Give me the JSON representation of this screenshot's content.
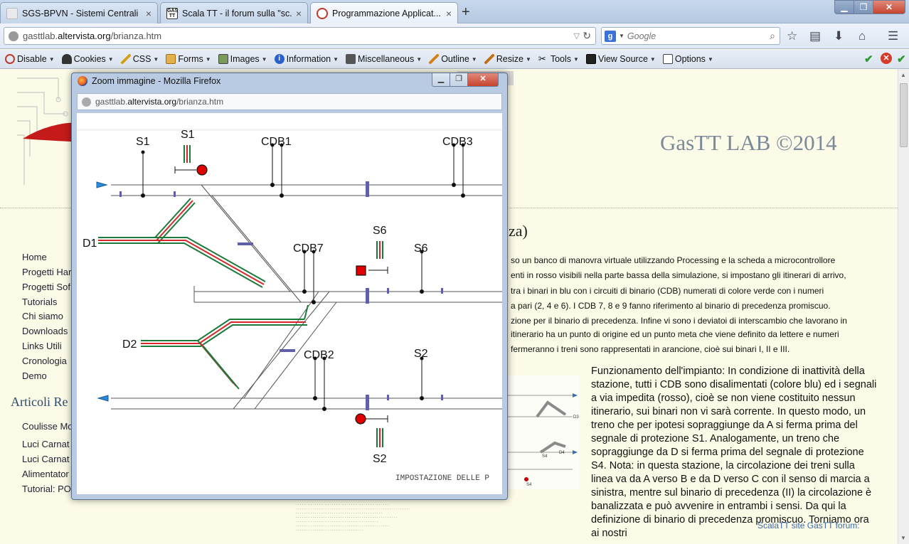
{
  "tabs": [
    {
      "title": "SGS-BPVN - Sistemi Centrali",
      "close": "×"
    },
    {
      "title": "Scala TT - il forum sulla \"sc...",
      "close": "×"
    },
    {
      "title": "Programmazione Applicat...",
      "close": "×"
    }
  ],
  "new_tab": "+",
  "url": {
    "domain_pre": "gasttlab.",
    "domain_main": "altervista.org",
    "path": "/brianza.htm"
  },
  "search": {
    "engine": "g",
    "placeholder": "Google"
  },
  "devbar": [
    "Disable",
    "Cookies",
    "CSS",
    "Forms",
    "Images",
    "Information",
    "Miscellaneous",
    "Outline",
    "Resize",
    "Tools",
    "View Source",
    "Options"
  ],
  "site": {
    "logo_title": "GasTT LAB ©2014",
    "menu": [
      "Home",
      "Progetti Har",
      "Progetti Sof",
      "Tutorials",
      "Chi siamo",
      "Downloads",
      "Links Utili",
      "Cronologia",
      "Demo"
    ],
    "articles_heading": "Articoli Re",
    "articles": [
      "Coulisse Mo",
      "Luci Carnat",
      "Luci Carnat",
      "Alimentator",
      "Tutorial: PO"
    ],
    "heading": "za)",
    "text_lines": [
      "so un banco di manovra virtuale utilizzando Processing e la scheda a microcontrollore",
      "enti in rosso visibili nella parte bassa della simulazione, si impostano gli itinerari di arrivo,",
      "tra i binari in blu con i circuiti di binario (CDB) numerati di colore verde con i numeri",
      "a pari (2, 4 e 6). I CDB 7, 8 e 9 fanno riferimento al binario di precedenza promiscuo.",
      "zione per il binario di precedenza. Infine vi sono i deviatoi di interscambio che lavorano in",
      "itinerario ha un punto di origine ed un punto meta che viene definito da lettere e numeri",
      "fermeranno i treni sono rappresentati in arancione, cioè sui binari I, II e III."
    ],
    "main_paragraph": "Funzionamento dell'impianto: In condizione di inattività della stazione, tutti i CDB sono disalimentati (colore blu) ed i segnali a via impedita (rosso), cioè se non viene costituito nessun itinerario, sui binari non vi sarà corrente. In questo modo, un treno che per ipotesi sopraggiunge da A si ferma prima del segnale di protezione S1. Analogamente, un treno che sopraggiunge da D si ferma prima del segnale di protezione S4. Nota: in questa stazione, la circolazione dei treni sulla linea va da A verso B e da D verso C con il senso di marcia a sinistra, mentre sul binario di precedenza (II) la circolazione è banalizzata e può avvenire in entrambi i sensi. Da qui la definizione di binario di precedenza promiscuo. Torniamo ora ai nostri",
    "footer_links": "ScalaTT site    GasTT forum:",
    "thumb_labels": {
      "d3": "D3",
      "d4": "D4",
      "s4a": "S4",
      "s4b": "S4"
    }
  },
  "popup": {
    "title": "Zoom immagine - Mozilla Firefox",
    "url_pre": "gasttlab.",
    "url_main": "altervista.org",
    "url_path": "/brianza.htm",
    "labels": {
      "s1_top": "S1",
      "s1_signal": "S1",
      "cdb1": "CDB1",
      "cdb3": "CDB3",
      "d1": "D1",
      "s6_signal": "S6",
      "cdb7": "CDB7",
      "s6": "S6",
      "d2": "D2",
      "cdb2": "CDB2",
      "s2": "S2",
      "s2_signal": "S2",
      "impostazione": "IMPOSTAZIONE DELLE P"
    }
  },
  "colors": {
    "accent": "#2e5a8f",
    "track_red": "#d62728",
    "track_green": "#1a7a3a",
    "cdb_blue": "#6060a8",
    "signal_red": "#e00000"
  }
}
